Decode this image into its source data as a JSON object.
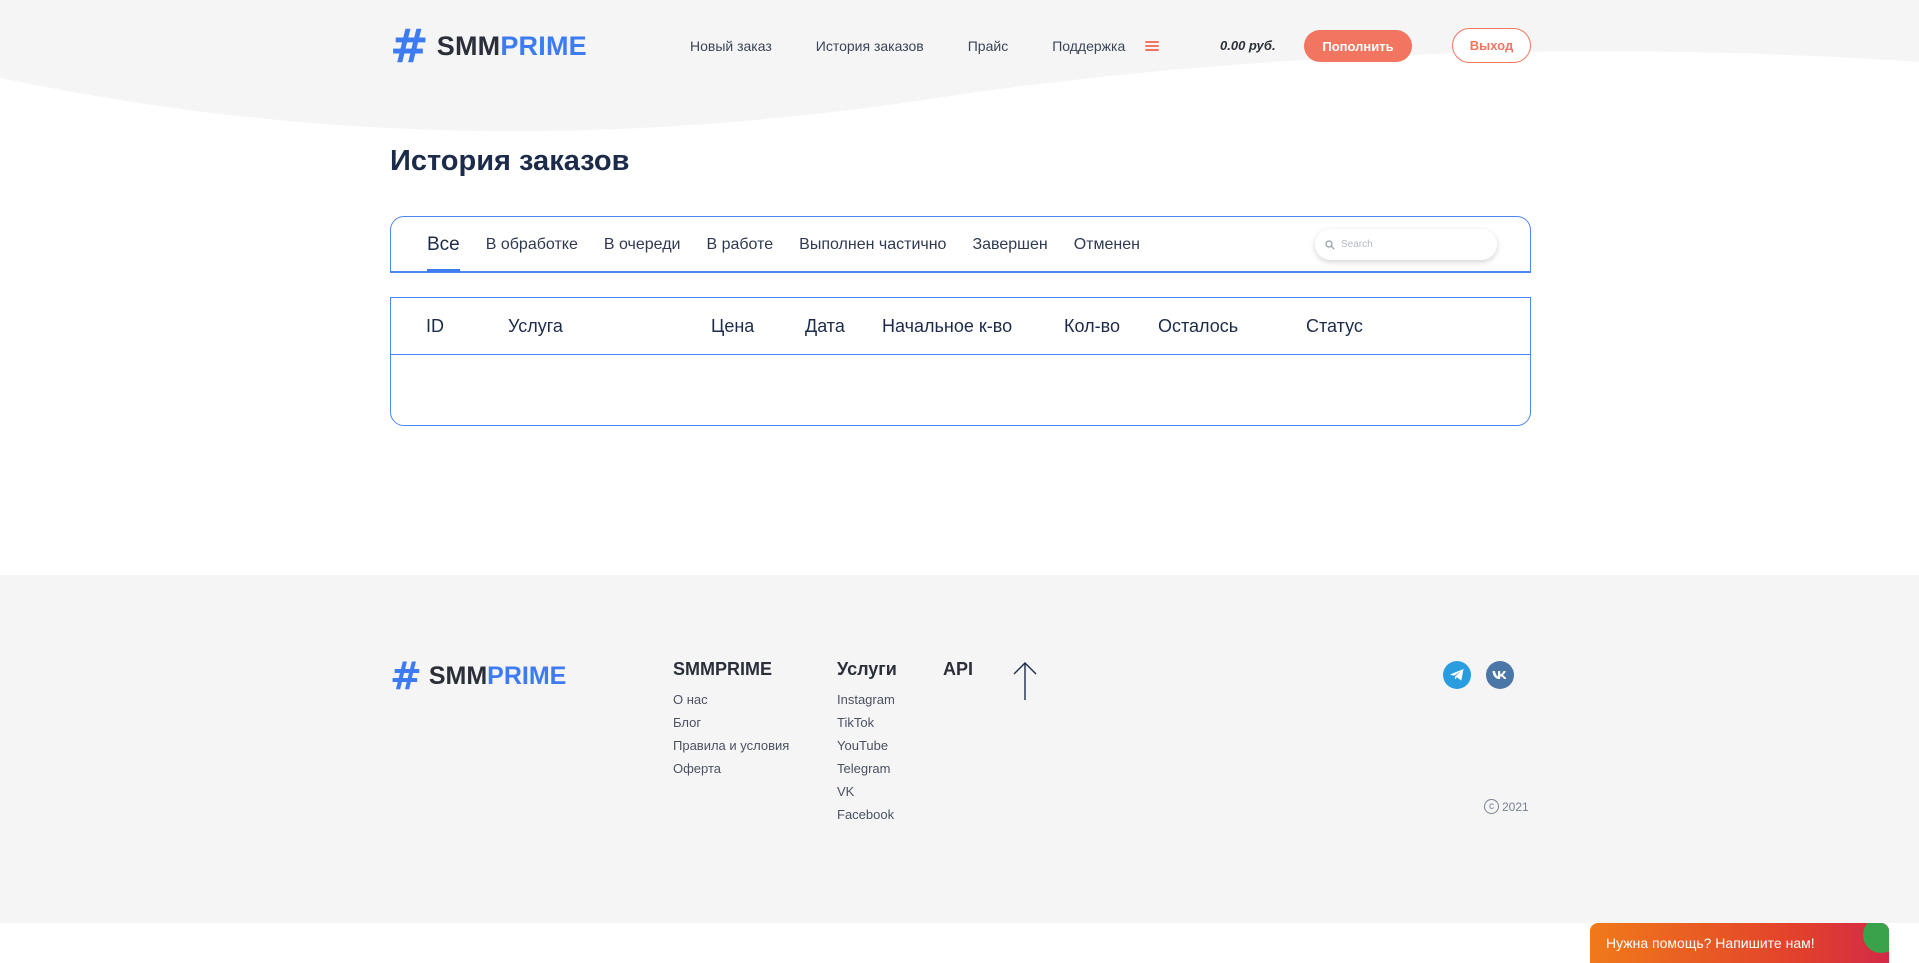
{
  "brand": {
    "hash": "#",
    "part1": "SMM",
    "part2": "PRIME"
  },
  "nav": {
    "items": [
      "Новый заказ",
      "История заказов",
      "Прайс",
      "Поддержка"
    ],
    "menu_icon": "hamburger-icon"
  },
  "account": {
    "balance": "0.00 руб.",
    "topup_label": "Пополнить",
    "logout_label": "Выход"
  },
  "colors": {
    "accent_blue": "#3d7bf2",
    "accent_coral": "#f2765f",
    "footer_bg": "#f5f5f5"
  },
  "page": {
    "title": "История заказов"
  },
  "tabs": {
    "items": [
      "Все",
      "В обработке",
      "В очереди",
      "В работе",
      "Выполнен частично",
      "Завершен",
      "Отменен"
    ],
    "active": "Все"
  },
  "search": {
    "placeholder": "Search",
    "icon": "search-icon"
  },
  "table": {
    "columns": [
      "ID",
      "Услуга",
      "Цена",
      "Дата",
      "Начальное к-во",
      "Кол-во",
      "Осталось",
      "Статус"
    ],
    "rows": []
  },
  "footer": {
    "col1": {
      "title": "SMMPRIME",
      "links": [
        "О нас",
        "Блог",
        "Правила и условия",
        "Оферта"
      ]
    },
    "col2": {
      "title": "Услуги",
      "links": [
        "Instagram",
        "TikTok",
        "YouTube",
        "Telegram",
        "VK",
        "Facebook"
      ]
    },
    "col3": {
      "title": "API"
    },
    "social": [
      "telegram-icon",
      "vk-icon"
    ],
    "copyright": "2021"
  },
  "help_widget": {
    "label": "Нужна помощь? Напишите нам!"
  }
}
